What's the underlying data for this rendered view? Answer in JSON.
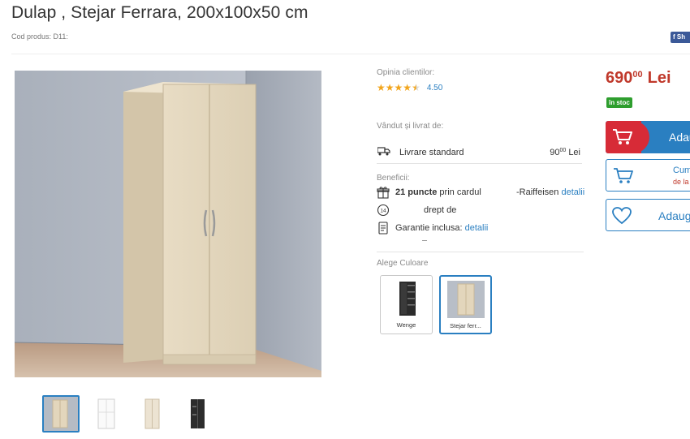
{
  "product": {
    "title": "Dulap  , Stejar Ferrara, 200x100x50 cm",
    "code_label": "Cod produs: D11:",
    "share_label": "Sh"
  },
  "rating": {
    "label": "Opinia clientilor:",
    "score": "4.50",
    "stars_value": 4.5,
    "stars_max": 5
  },
  "seller": {
    "label": "Vândut și livrat de:"
  },
  "delivery": {
    "name": "Livrare standard",
    "price_int": "90",
    "price_dec": "00",
    "currency": "Lei"
  },
  "benefits": {
    "label": "Beneficii:",
    "points_bold": "21 puncte",
    "points_text": " prin cardul",
    "raiffeisen": "Raiffeisen",
    "details_link": "detalii",
    "return_num": "14",
    "return_text": "drept de",
    "warranty_text": "Garantie inclusa: ",
    "warranty_link": "detalii"
  },
  "colors": {
    "label": "Alege Culoare",
    "options": [
      {
        "name": "Wenge",
        "selected": false
      },
      {
        "name": "Stejar ferr...",
        "selected": true
      }
    ]
  },
  "price": {
    "int": "690",
    "dec": "00",
    "currency": "Lei",
    "stock_badge": "în stoc"
  },
  "buttons": {
    "add_label": "Adau",
    "buy_line1": "Cum",
    "buy_line2": "de la",
    "fav_label": "Adaug"
  },
  "colors_hex": {
    "accent": "#2a7fc1",
    "price": "#c0392b",
    "stock": "#2e9e2e",
    "cart": "#d72b37",
    "stars": "#f2a51c"
  }
}
